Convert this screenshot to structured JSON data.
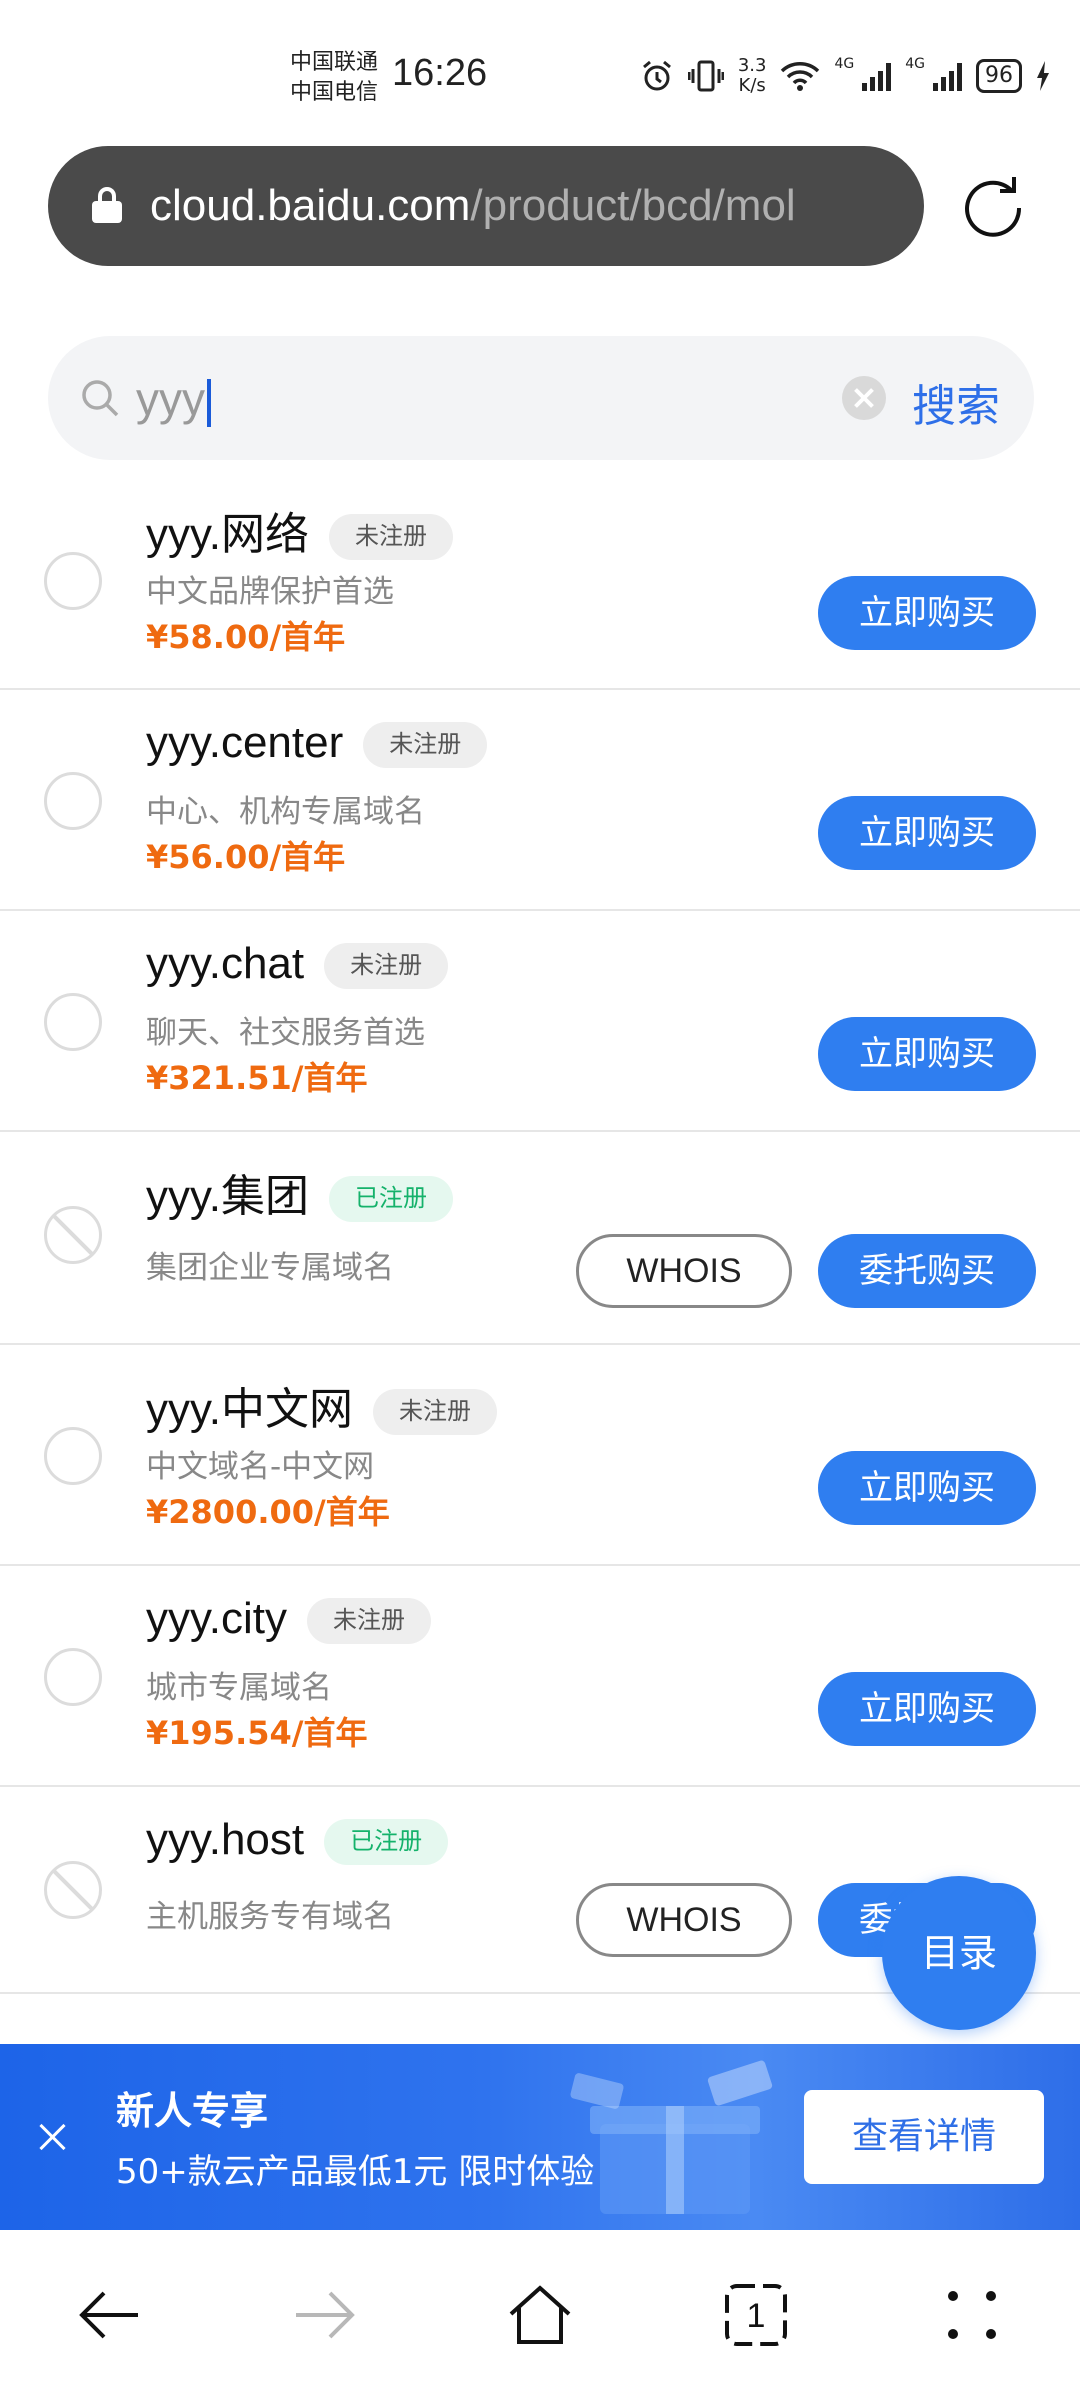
{
  "status_bar": {
    "carrier_1": "中国联通",
    "carrier_2": "中国电信",
    "time": "16:26",
    "speed_value": "3.3",
    "speed_unit": "K/s",
    "net_1": "4G",
    "net_2": "4G",
    "battery": "96"
  },
  "browser": {
    "url_host": "cloud.baidu.com",
    "url_path": "/product/bcd/mol"
  },
  "search": {
    "query": "yyy",
    "button_label": "搜索"
  },
  "domains": [
    {
      "name": "yyy.网络",
      "status": "未注册",
      "registered": false,
      "desc": "中文品牌保护首选",
      "price": "¥58.00/首年",
      "action": "立即购买"
    },
    {
      "name": "yyy.center",
      "status": "未注册",
      "registered": false,
      "desc": "中心、机构专属域名",
      "price": "¥56.00/首年",
      "action": "立即购买"
    },
    {
      "name": "yyy.chat",
      "status": "未注册",
      "registered": false,
      "desc": "聊天、社交服务首选",
      "price": "¥321.51/首年",
      "action": "立即购买"
    },
    {
      "name": "yyy.集团",
      "status": "已注册",
      "registered": true,
      "desc": "集团企业专属域名",
      "whois": "WHOIS",
      "action": "委托购买"
    },
    {
      "name": "yyy.中文网",
      "status": "未注册",
      "registered": false,
      "desc": "中文域名-中文网",
      "price": "¥2800.00/首年",
      "action": "立即购买"
    },
    {
      "name": "yyy.city",
      "status": "未注册",
      "registered": false,
      "desc": "城市专属域名",
      "price": "¥195.54/首年",
      "action": "立即购买"
    },
    {
      "name": "yyy.host",
      "status": "已注册",
      "registered": true,
      "desc": "主机服务专有域名",
      "whois": "WHOIS",
      "action": "委托购买"
    }
  ],
  "floating_button": "目录",
  "promo_banner": {
    "title": "新人专享",
    "subtitle": "50+款云产品最低1元 限时体验",
    "button": "查看详情"
  },
  "colors": {
    "primary": "#2f7ef0",
    "price": "#ef6a10",
    "registered_badge": "#15b26b"
  },
  "icons": [
    "lock-icon",
    "reload-icon",
    "search-icon",
    "clear-icon",
    "close-icon",
    "back-icon",
    "forward-icon",
    "home-icon",
    "tabs-icon",
    "menu-icon"
  ]
}
